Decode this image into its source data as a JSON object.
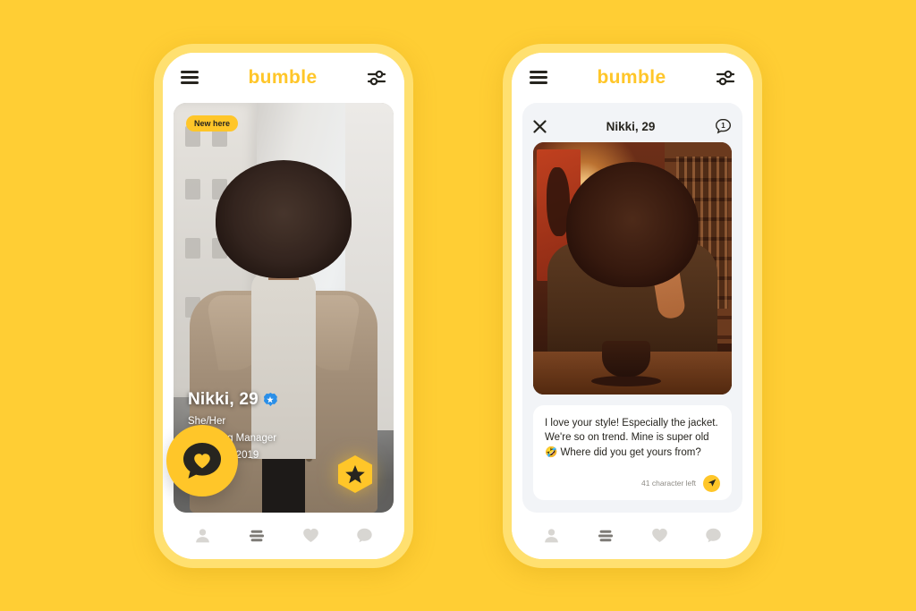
{
  "theme": {
    "background": "#FFCE34",
    "phone_bezel": "#FFE070",
    "brand_yellow": "#FFC629",
    "ink": "#27251F",
    "verified_blue": "#2A8FE8",
    "panel_gray": "#F2F4F7"
  },
  "brand": {
    "name": "bumble"
  },
  "icons": {
    "menu": "hamburger-menu-icon",
    "filter": "filter-sliders-icon",
    "close": "close-icon",
    "messages": "message-count-icon",
    "send": "send-paper-plane-icon",
    "superswipe": "superswipe-star-icon",
    "chat_fab": "chat-heart-icon"
  },
  "left_phone": {
    "topbar": {
      "title": "bumble"
    },
    "card": {
      "badge": "New here",
      "name": "Nikki, 29",
      "verified": true,
      "pronouns": "She/Her",
      "job": "Marketing Manager",
      "education": "University 2019"
    },
    "nav": [
      {
        "name": "profile",
        "label": "Profile",
        "active": false
      },
      {
        "name": "hive",
        "label": "Hive",
        "active": true
      },
      {
        "name": "likes",
        "label": "Likes",
        "active": false
      },
      {
        "name": "chats",
        "label": "Chats",
        "active": false
      }
    ]
  },
  "right_phone": {
    "topbar": {
      "title": "bumble"
    },
    "chat": {
      "title": "Nikki, 29",
      "message_count": "1",
      "compose_value": "I love your style! Especially the jacket. We're so on trend. Mine is super old 🤣 Where did you get yours from?",
      "char_left": "41 character left"
    },
    "nav": [
      {
        "name": "profile",
        "label": "Profile",
        "active": false
      },
      {
        "name": "hive",
        "label": "Hive",
        "active": true
      },
      {
        "name": "likes",
        "label": "Likes",
        "active": false
      },
      {
        "name": "chats",
        "label": "Chats",
        "active": false
      }
    ]
  }
}
